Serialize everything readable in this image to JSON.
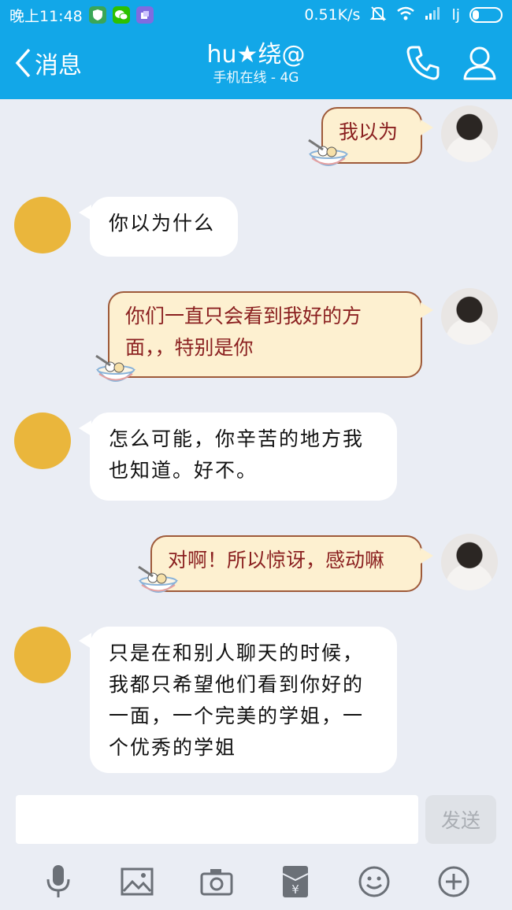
{
  "status_bar": {
    "time": "晚上11:48",
    "speed": "0.51K/s",
    "carrier_mark": "lj",
    "app_icons": [
      "shield-icon",
      "wechat-icon",
      "notification-icon"
    ]
  },
  "header": {
    "back_label": "消息",
    "title": "hu★绕@",
    "subtitle": "手机在线 - 4G",
    "icons": [
      "phone-icon",
      "profile-icon"
    ]
  },
  "messages": [
    {
      "sender": "me",
      "text": "我以为"
    },
    {
      "sender": "other",
      "text": "你以为什么"
    },
    {
      "sender": "me",
      "line1": "你们一直只会看到我好的方",
      "line2": "面，，特别是你"
    },
    {
      "sender": "other",
      "line1": "怎么可能，你辛苦的地方我",
      "line2": "也知道。好不。"
    },
    {
      "sender": "me",
      "text": "对啊！所以惊讶，感动嘛"
    },
    {
      "sender": "other",
      "line1": "只是在和别人聊天的时候，",
      "line2": "我都只希望他们看到你好的",
      "line3": "一面，一个完美的学姐，一",
      "line4": "个优秀的学姐"
    }
  ],
  "input": {
    "value": "",
    "send_label": "发送"
  },
  "toolbar": [
    "microphone-icon",
    "image-icon",
    "camera-icon",
    "red-packet-icon",
    "emoji-icon",
    "plus-icon"
  ],
  "colors": {
    "header_bg": "#12a7e8",
    "chat_bg": "#eaedf4",
    "my_bubble": "#fdf0d0",
    "my_text": "#8a1f1f",
    "other_bubble": "#ffffff"
  }
}
